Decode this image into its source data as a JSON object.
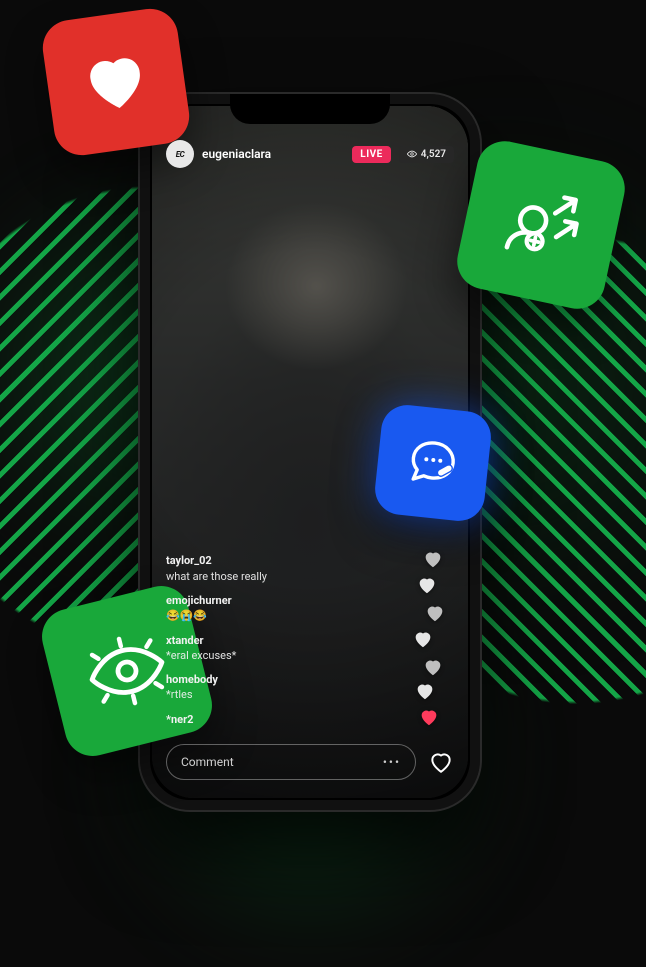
{
  "stream": {
    "username": "eugeniaclara",
    "live_label": "LIVE",
    "viewer_count": "4,527"
  },
  "comments": [
    {
      "user": "taylor_02",
      "text": "what are those really"
    },
    {
      "user": "emojichurner",
      "text": "😂😭😂"
    },
    {
      "user": "xtander",
      "text": "*eral excuses*"
    },
    {
      "user": "homebody",
      "text": "*rtles"
    },
    {
      "user": "*ner2",
      "text": ""
    }
  ],
  "input": {
    "placeholder": "Comment",
    "more": "•••"
  },
  "icons": {
    "heart": "heart-icon",
    "add_user": "add-user-icon",
    "chat": "chat-edit-icon",
    "eye": "eye-icon"
  },
  "colors": {
    "green": "#19a83a",
    "red": "#e1302a",
    "blue": "#1959f0"
  }
}
